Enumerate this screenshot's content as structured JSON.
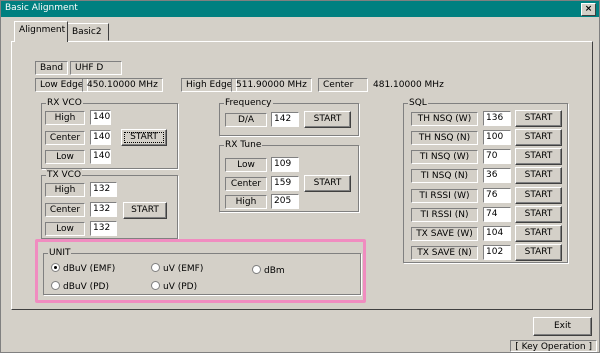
{
  "window": {
    "title": "Basic Alignment",
    "close_label": "×"
  },
  "tabs": [
    {
      "label": "Alignment"
    },
    {
      "label": "Basic2"
    }
  ],
  "band": {
    "label": "Band",
    "value": "UHF D"
  },
  "edges": {
    "low_label": "Low Edge",
    "low_value": "450.10000 MHz",
    "high_label": "High Edge",
    "high_value": "511.90000 MHz",
    "center_label": "Center",
    "center_value": "481.10000 MHz"
  },
  "rx_vco": {
    "title": "RX VCO",
    "high_label": "High",
    "high_value": "140",
    "center_label": "Center",
    "center_value": "140",
    "low_label": "Low",
    "low_value": "140",
    "start_label": "START"
  },
  "tx_vco": {
    "title": "TX VCO",
    "high_label": "High",
    "high_value": "132",
    "center_label": "Center",
    "center_value": "132",
    "low_label": "Low",
    "low_value": "132",
    "start_label": "START"
  },
  "frequency": {
    "title": "Frequency",
    "da_label": "D/A",
    "da_value": "142",
    "start_label": "START"
  },
  "rx_tune": {
    "title": "RX Tune",
    "low_label": "Low",
    "low_value": "109",
    "center_label": "Center",
    "center_value": "159",
    "high_label": "High",
    "high_value": "205",
    "start_label": "START"
  },
  "sql": {
    "title": "SQL",
    "start_label": "START",
    "rows": [
      {
        "label": "TH NSQ (W)",
        "value": "136"
      },
      {
        "label": "TH NSQ (N)",
        "value": "100"
      },
      {
        "label": "TI NSQ (W)",
        "value": "70"
      },
      {
        "label": "TI NSQ (N)",
        "value": "36"
      },
      {
        "label": "TI RSSI (W)",
        "value": "76"
      },
      {
        "label": "TI RSSI (N)",
        "value": "74"
      },
      {
        "label": "TX SAVE (W)",
        "value": "104"
      },
      {
        "label": "TX SAVE (N)",
        "value": "102"
      }
    ]
  },
  "unit": {
    "title": "UNIT",
    "options": [
      {
        "label": "dBuV (EMF)",
        "selected": true
      },
      {
        "label": "uV (EMF)",
        "selected": false
      },
      {
        "label": "dBm",
        "selected": false
      },
      {
        "label": "dBuV (PD)",
        "selected": false
      },
      {
        "label": "uV (PD)",
        "selected": false
      }
    ]
  },
  "exit_label": "Exit",
  "status_text": "[ Key Operation ]",
  "colors": {
    "title_bar": "#008080",
    "highlight": "#f08cc0",
    "face": "#d4d0c8"
  }
}
